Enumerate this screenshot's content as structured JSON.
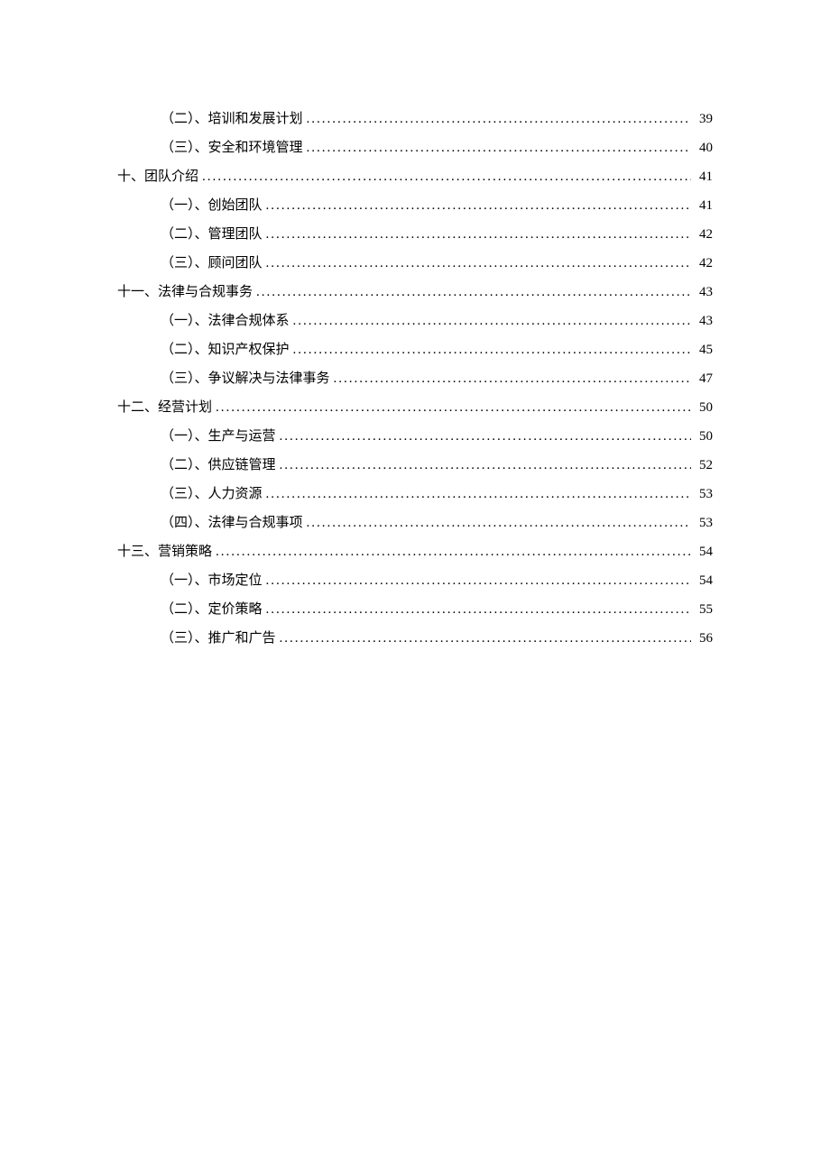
{
  "toc": [
    {
      "level": 2,
      "label": "（二）、培训和发展计划",
      "page": "39"
    },
    {
      "level": 2,
      "label": "（三）、安全和环境管理",
      "page": "40"
    },
    {
      "level": 1,
      "label": "十、团队介绍",
      "page": "41"
    },
    {
      "level": 2,
      "label": "（一）、创始团队",
      "page": "41"
    },
    {
      "level": 2,
      "label": "（二）、管理团队",
      "page": "42"
    },
    {
      "level": 2,
      "label": "（三）、顾问团队",
      "page": "42"
    },
    {
      "level": 1,
      "label": "十一、法律与合规事务",
      "page": "43"
    },
    {
      "level": 2,
      "label": "（一）、法律合规体系",
      "page": "43"
    },
    {
      "level": 2,
      "label": "（二）、知识产权保护",
      "page": "45"
    },
    {
      "level": 2,
      "label": "（三）、争议解决与法律事务",
      "page": "47"
    },
    {
      "level": 1,
      "label": "十二、经营计划",
      "page": "50"
    },
    {
      "level": 2,
      "label": "（一）、生产与运营",
      "page": "50"
    },
    {
      "level": 2,
      "label": "（二）、供应链管理",
      "page": "52"
    },
    {
      "level": 2,
      "label": "（三）、人力资源",
      "page": "53"
    },
    {
      "level": 2,
      "label": "（四）、法律与合规事项",
      "page": "53"
    },
    {
      "level": 1,
      "label": "十三、营销策略",
      "page": "54"
    },
    {
      "level": 2,
      "label": "（一）、市场定位",
      "page": "54"
    },
    {
      "level": 2,
      "label": "（二）、定价策略",
      "page": "55"
    },
    {
      "level": 2,
      "label": "（三）、推广和广告",
      "page": "56"
    }
  ]
}
